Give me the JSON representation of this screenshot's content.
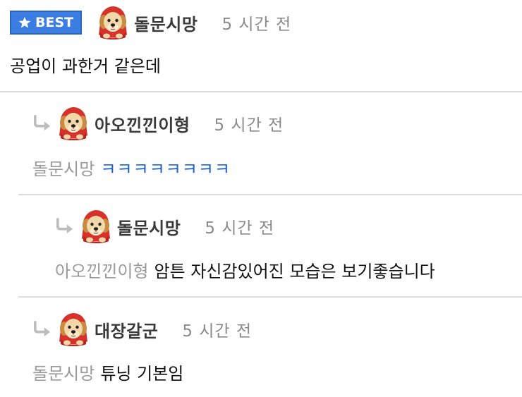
{
  "comments": [
    {
      "badge": "BEST",
      "username": "돌문시망",
      "time": "5 시간 전",
      "text": "공업이 과한거 같은데"
    },
    {
      "username": "아오낀낀이형",
      "time": "5 시간 전",
      "mention": "돌문시망",
      "text": "ㅋㅋㅋㅋㅋㅋㅋㅋ"
    },
    {
      "username": "돌문시망",
      "time": "5 시간 전",
      "mention": "아오낀낀이형",
      "text": "암튼 자신감있어진 모습은 보기좋습니다"
    },
    {
      "username": "대장갈군",
      "time": "5 시간 전",
      "mention": "돌문시망",
      "text": "튜닝 기본임"
    }
  ],
  "colors": {
    "best_badge": "#3b7de0",
    "link_text": "#1f62c9",
    "mention": "#9a9a9a",
    "divider": "#dcdcdc"
  },
  "icons": {
    "badge": "star-icon",
    "reply": "reply-arrow-icon",
    "avatar": "puppy-avatar"
  }
}
